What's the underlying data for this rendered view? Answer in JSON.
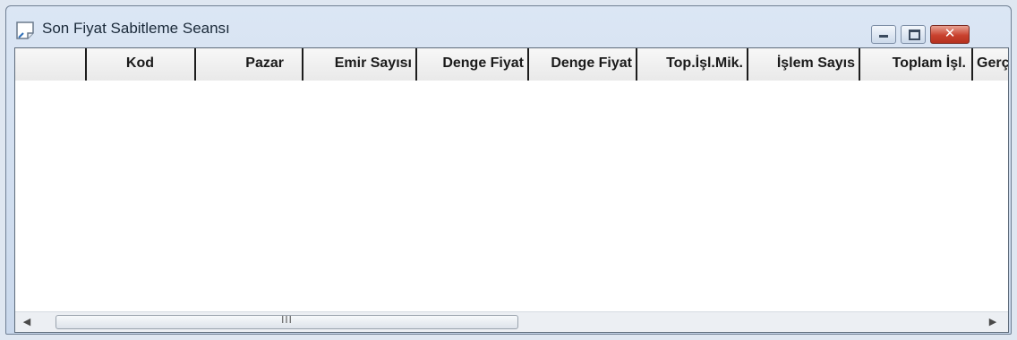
{
  "window": {
    "title": "Son Fiyat Sabitleme Seansı",
    "title_icon": "document-icon",
    "controls": {
      "minimize_icon": "minimize-icon",
      "maximize_icon": "maximize-icon",
      "close_glyph": "✕"
    },
    "accent_color": "#c9422f"
  },
  "grid": {
    "columns": [
      {
        "label": ""
      },
      {
        "label": "Kod"
      },
      {
        "label": "Pazar"
      },
      {
        "label": "Emir Sayısı"
      },
      {
        "label": "Denge Fiyat"
      },
      {
        "label": "Denge Fiyat"
      },
      {
        "label": "Top.İşl.Mik."
      },
      {
        "label": "İşlem Sayıs"
      },
      {
        "label": "Toplam İşl."
      },
      {
        "label": "Gerç"
      }
    ],
    "rows": []
  },
  "scrollbar": {
    "left_arrow": "◀",
    "right_arrow": "▶",
    "grip": "III"
  }
}
